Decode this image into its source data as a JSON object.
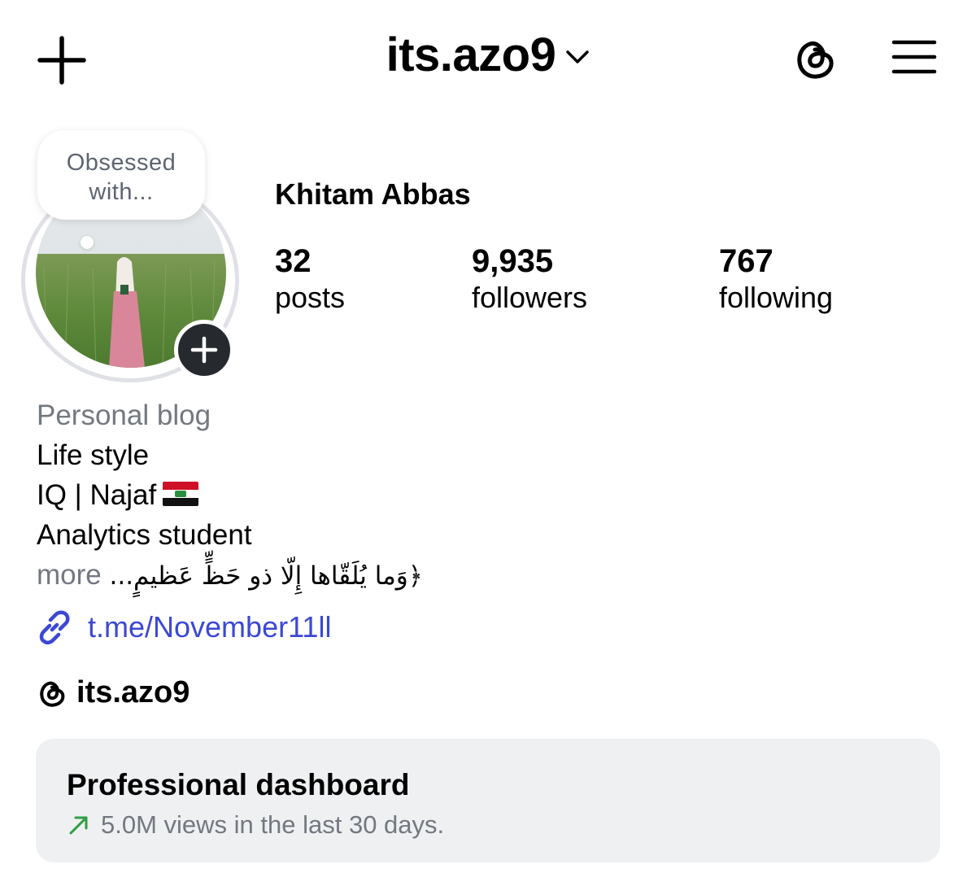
{
  "header": {
    "username": "its.azo9",
    "icons": {
      "create": "plus-icon",
      "switch_account": "chevron-down-icon",
      "threads": "threads-icon",
      "menu": "hamburger-menu-icon"
    }
  },
  "profile": {
    "note_bubble": [
      "Obsessed",
      "with..."
    ],
    "display_name": "Khitam Abbas",
    "stats": [
      {
        "value": "32",
        "label": "posts"
      },
      {
        "value": "9,935",
        "label": "followers"
      },
      {
        "value": "767",
        "label": "following"
      }
    ]
  },
  "bio": {
    "category": "Personal blog",
    "lines": [
      "Life style",
      "IQ | Najaf",
      "Analytics student"
    ],
    "flag": "Iraq flag",
    "quote_line": "﴿وَما يُلَقّاها إِلّا ذو حَظٍّ عَظيمٍ...",
    "more": "more",
    "link": "t.me/November11ll",
    "threads_handle": "its.azo9"
  },
  "dashboard": {
    "title": "Professional dashboard",
    "subtitle": "5.0M views in the last 30 days.",
    "trend_color": "#2f9e44"
  },
  "colors": {
    "link": "#3b48d4",
    "muted": "#737880",
    "card": "#eff0f2"
  }
}
